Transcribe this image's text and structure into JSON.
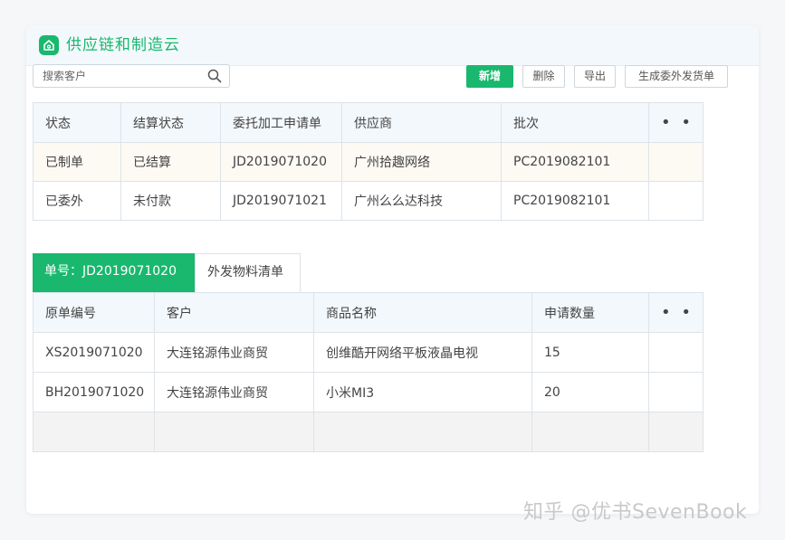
{
  "app": {
    "title": "供应链和制造云",
    "icon": "home-icon",
    "accent": "#19b86e"
  },
  "search": {
    "placeholder": "搜索客户",
    "icon": "search-icon"
  },
  "toolbar": {
    "new_label": "新增",
    "delete_label": "删除",
    "export_label": "导出",
    "generate_label": "生成委外发货单"
  },
  "orders": {
    "columns": [
      "状态",
      "结算状态",
      "委托加工申请单",
      "供应商",
      "批次"
    ],
    "more": "• • •",
    "rows": [
      [
        "已制单",
        "已结算",
        "JD2019071020",
        "广州拾趣网络",
        "PC2019082101"
      ],
      [
        "已委外",
        "未付款",
        "JD2019071021",
        "广州么么达科技",
        "PC2019082101"
      ]
    ]
  },
  "detail_tabs": {
    "active": "单号：JD2019071020",
    "inactive": "外发物料清单"
  },
  "materials": {
    "columns": [
      "原单编号",
      "客户",
      "商品名称",
      "申请数量"
    ],
    "more": "• • •",
    "rows": [
      [
        "XS2019071020",
        "大连铭源伟业商贸",
        "创维酷开网络平板液晶电视",
        "15"
      ],
      [
        "BH2019071020",
        "大连铭源伟业商贸",
        "小米MI3",
        "20"
      ]
    ]
  },
  "watermark": "知乎 @优书SevenBook"
}
